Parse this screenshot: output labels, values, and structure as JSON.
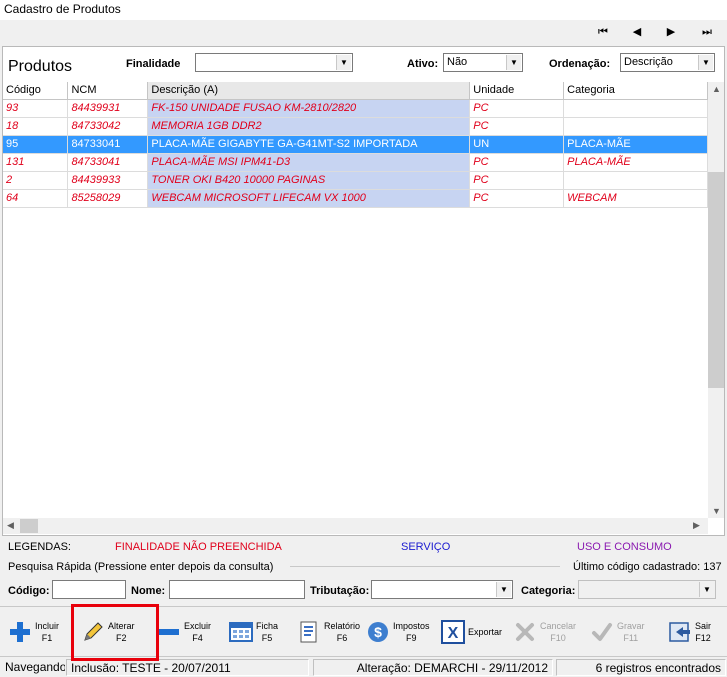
{
  "window": {
    "title": "Cadastro de Produtos"
  },
  "nav": {
    "first": "⏮",
    "prev": "◀",
    "next": "▶",
    "last": "⏭"
  },
  "header": {
    "title": "Produtos",
    "finalidade_label": "Finalidade",
    "finalidade_value": "",
    "ativo_label": "Ativo:",
    "ativo_value": "Não",
    "ordenacao_label": "Ordenação:",
    "ordenacao_value": "Descrição"
  },
  "grid": {
    "columns": [
      "Código",
      "NCM",
      "Descrição (A)",
      "Unidade",
      "Categoria"
    ],
    "rows": [
      {
        "codigo": "93",
        "ncm": "84439931",
        "descricao": "FK-150 UNIDADE FUSAO KM-2810/2820",
        "unidade": "PC",
        "categoria": ""
      },
      {
        "codigo": "18",
        "ncm": "84733042",
        "descricao": "MEMORIA 1GB DDR2",
        "unidade": "PC",
        "categoria": ""
      },
      {
        "codigo": "95",
        "ncm": "84733041",
        "descricao": "PLACA-MÃE GIGABYTE GA-G41MT-S2 IMPORTADA",
        "unidade": "UN",
        "categoria": "PLACA-MÃE"
      },
      {
        "codigo": "131",
        "ncm": "84733041",
        "descricao": "PLACA-MÃE MSI IPM41-D3",
        "unidade": "PC",
        "categoria": "PLACA-MÃE"
      },
      {
        "codigo": "2",
        "ncm": "84439933",
        "descricao": "TONER OKI B420 10000 PAGINAS",
        "unidade": "PC",
        "categoria": ""
      },
      {
        "codigo": "64",
        "ncm": "85258029",
        "descricao": "WEBCAM MICROSOFT LIFECAM VX 1000",
        "unidade": "PC",
        "categoria": "WEBCAM"
      }
    ],
    "selected_index": 2
  },
  "legend": {
    "label": "LEGENDAS:",
    "item1": "FINALIDADE NÃO PREENCHIDA",
    "item2": "SERVIÇO",
    "item3": "USO E CONSUMO",
    "colors": {
      "item1": "#e0001b",
      "item2": "#1a1ad0",
      "item3": "#8a1ab0"
    }
  },
  "search": {
    "title": "Pesquisa Rápida (Pressione enter depois da consulta)",
    "last_code": "Último código cadastrado: 137",
    "codigo_label": "Código:",
    "nome_label": "Nome:",
    "tributacao_label": "Tributação:",
    "categoria_label": "Categoria:"
  },
  "toolbar": {
    "incluir": "Incluir",
    "incluir_key": "F1",
    "alterar": "Alterar",
    "alterar_key": "F2",
    "excluir": "Excluir",
    "excluir_key": "F4",
    "ficha": "Ficha",
    "ficha_key": "F5",
    "relatorio": "Relatório",
    "relatorio_key": "F6",
    "impostos": "Impostos",
    "impostos_key": "F9",
    "exportar": "Exportar",
    "cancelar": "Cancelar",
    "cancelar_key": "F10",
    "gravar": "Gravar",
    "gravar_key": "F11",
    "sair": "Sair",
    "sair_key": "F12"
  },
  "status": {
    "mode": "Navegando",
    "inclusao": "Inclusão: TESTE - 20/07/2011",
    "alteracao": "Alteração: DEMARCHI - 29/11/2012",
    "registros": "6 registros encontrados"
  }
}
